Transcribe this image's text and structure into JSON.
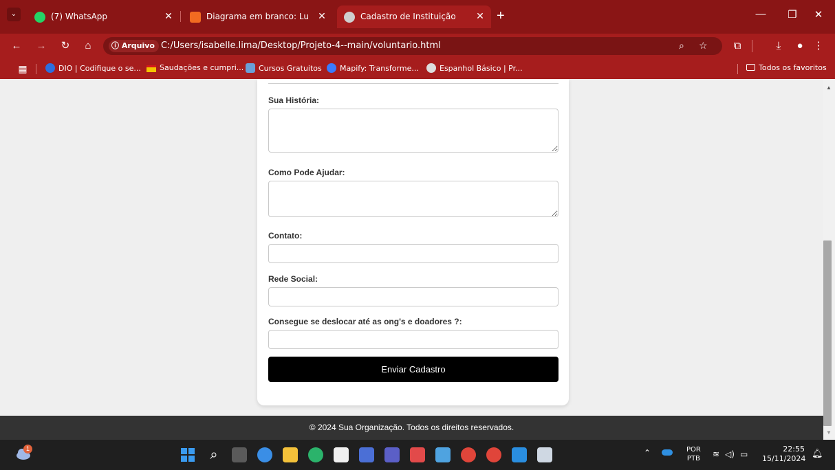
{
  "browser": {
    "tabs": [
      {
        "title": "(7) WhatsApp",
        "icon": "whatsapp-icon",
        "color": "#25d366"
      },
      {
        "title": "Diagrama em branco: Lucidchar",
        "icon": "lucidchart-icon",
        "color": "#f26b21"
      },
      {
        "title": "Cadastro de Instituição",
        "icon": "globe-icon",
        "color": "#cfcfcf"
      }
    ],
    "address": {
      "security_label": "ⓘ Arquivo",
      "url": "C:/Users/isabelle.lima/Desktop/Projeto-4--main/voluntario.html"
    },
    "bookmarks": [
      {
        "label": "DIO | Codifique o se...",
        "icon": "dio-icon",
        "color": "#2d6fdf"
      },
      {
        "label": "Saudações e cumpri...",
        "icon": "flag-icon",
        "color": "#f5c400"
      },
      {
        "label": "Cursos Gratuitos",
        "icon": "courses-icon",
        "color": "#6aa0d8"
      },
      {
        "label": "Mapify: Transforme...",
        "icon": "mapify-icon",
        "color": "#3a7bff"
      },
      {
        "label": "Espanhol Básico | Pr...",
        "icon": "spanish-icon",
        "color": "#dddddd"
      }
    ],
    "all_bookmarks": "Todos os favoritos"
  },
  "form": {
    "historia_label": "Sua História:",
    "ajudar_label": "Como Pode Ajudar:",
    "contato_label": "Contato:",
    "rede_label": "Rede Social:",
    "deslocar_label": "Consegue se deslocar até as ong's e doadores ?:",
    "submit_label": "Enviar Cadastro"
  },
  "footer": {
    "text": "© 2024 Sua Organização. Todos os direitos reservados."
  },
  "taskbar": {
    "notification_count": "1",
    "language": "POR",
    "layout": "PTB",
    "time": "22:55",
    "date": "15/11/2024"
  },
  "colors": {
    "tabbar": "#8a1515",
    "toolbar": "#a61d1d",
    "button": "#000000",
    "footer": "#333333"
  }
}
